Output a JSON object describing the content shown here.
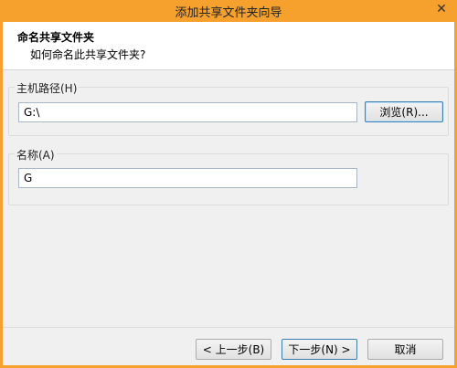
{
  "window": {
    "title": "添加共享文件夹向导",
    "close_glyph": "✕"
  },
  "header": {
    "title": "命名共享文件夹",
    "subtitle": "如何命名此共享文件夹?"
  },
  "host_path_group": {
    "label": "主机路径(H)",
    "value": "G:\\",
    "browse_label": "浏览(R)..."
  },
  "name_group": {
    "label": "名称(A)",
    "value": "G"
  },
  "footer": {
    "back_label": "< 上一步(B)",
    "next_label": "下一步(N) >",
    "cancel_label": "取消"
  },
  "colors": {
    "titlebar": "#f6a12e",
    "client_bg": "#f0f0f0",
    "focus_border": "#3c7fb1"
  },
  "icons": {
    "close": "close-icon"
  }
}
